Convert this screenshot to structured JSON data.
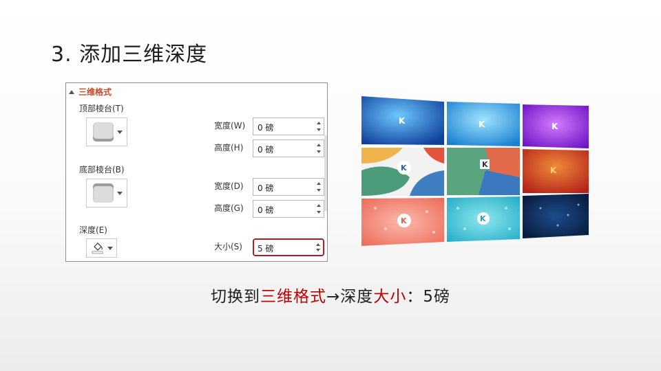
{
  "slide": {
    "title": "3. 添加三维深度"
  },
  "panel": {
    "section_title": "三维格式",
    "top_bevel": {
      "label": "顶部棱台(T)",
      "width_label": "宽度(W)",
      "width_value": "0 磅",
      "height_label": "高度(H)",
      "height_value": "0 磅"
    },
    "bottom_bevel": {
      "label": "底部棱台(B)",
      "width_label": "宽度(D)",
      "width_value": "0 磅",
      "height_label": "高度(G)",
      "height_value": "0 磅"
    },
    "depth": {
      "label": "深度(E)",
      "size_label": "大小(S)",
      "size_value": "5 磅"
    }
  },
  "caption": {
    "part1": "切换到",
    "part2": "三维格式",
    "part3": "→深度",
    "part4": "大小",
    "part5": "：5磅"
  },
  "tiles": {
    "mark": "K",
    "colors": [
      "#1a64b8",
      "#2596d8",
      "#8a1fd4",
      "#e9a64a",
      "#5aa57f",
      "#c9321b",
      "#ee7563",
      "#34c0d3",
      "#0e2f63"
    ]
  },
  "colors": {
    "accent_red": "#c00000",
    "panel_title": "#c8472a",
    "highlight_border": "#b01c24"
  }
}
